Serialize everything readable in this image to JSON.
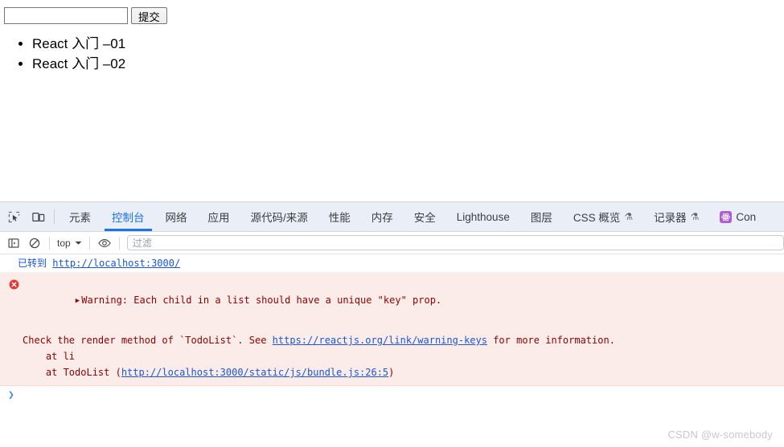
{
  "page": {
    "form": {
      "input_value": "",
      "input_placeholder": "",
      "submit_label": "提交"
    },
    "todos": [
      {
        "label": "React 入门 –01"
      },
      {
        "label": "React 入门 –02"
      }
    ]
  },
  "devtools": {
    "tabs": [
      {
        "label": "元素",
        "active": false,
        "experimental": false
      },
      {
        "label": "控制台",
        "active": true,
        "experimental": false
      },
      {
        "label": "网络",
        "active": false,
        "experimental": false
      },
      {
        "label": "应用",
        "active": false,
        "experimental": false
      },
      {
        "label": "源代码/来源",
        "active": false,
        "experimental": false
      },
      {
        "label": "性能",
        "active": false,
        "experimental": false
      },
      {
        "label": "内存",
        "active": false,
        "experimental": false
      },
      {
        "label": "安全",
        "active": false,
        "experimental": false
      },
      {
        "label": "Lighthouse",
        "active": false,
        "experimental": false
      },
      {
        "label": "图层",
        "active": false,
        "experimental": false
      },
      {
        "label": "CSS 概览",
        "active": false,
        "experimental": true
      },
      {
        "label": "记录器",
        "active": false,
        "experimental": true
      },
      {
        "label": "Con",
        "active": false,
        "experimental": false,
        "badge": "react-logo-icon"
      }
    ],
    "experimental_glyph": "⚗",
    "console_toolbar": {
      "context_label": "top",
      "filter_placeholder": "过滤"
    },
    "console_messages": {
      "navigation": {
        "prefix": "已转到",
        "url": "http://localhost:3000/"
      },
      "error": {
        "title": "Warning: Each child in a list should have a unique \"key\" prop.",
        "body_before_link": "Check the render method of `TodoList`. See ",
        "link_text": "https://reactjs.org/link/warning-keys",
        "body_after_link": " for more information.",
        "stack": [
          {
            "text": "    at li",
            "link": ""
          },
          {
            "text": "    at TodoList (",
            "link": "http://localhost:3000/static/js/bundle.js:26:5",
            "suffix": ")"
          }
        ]
      }
    },
    "prompt_caret": "❯"
  },
  "watermark": "CSDN @w-somebody",
  "colors": {
    "accent": "#1a73e8",
    "tabbar_bg": "#eaeef6",
    "error_bg": "#fcece9",
    "error_text": "#8b0000",
    "link": "#1a56d6",
    "react_badge": "#ad5cd4"
  }
}
